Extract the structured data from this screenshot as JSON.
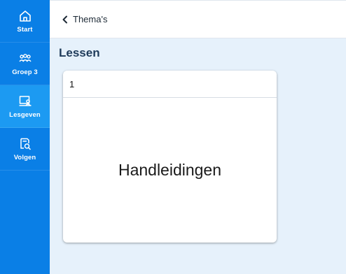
{
  "sidebar": {
    "items": [
      {
        "label": "Start",
        "icon": "home-icon",
        "active": false
      },
      {
        "label": "Groep 3",
        "icon": "group-icon",
        "active": false
      },
      {
        "label": "Lesgeven",
        "icon": "presentation-icon",
        "active": true
      },
      {
        "label": "Volgen",
        "icon": "document-search-icon",
        "active": false
      }
    ]
  },
  "header": {
    "back_label": "Thema's"
  },
  "main": {
    "title": "Lessen",
    "card": {
      "number": "1",
      "title": "Handleidingen"
    }
  },
  "colors": {
    "sidebar": "#0a7fe6",
    "sidebar_active": "#1c9af2",
    "background": "#e6f1fb",
    "title": "#1f3b5a"
  }
}
